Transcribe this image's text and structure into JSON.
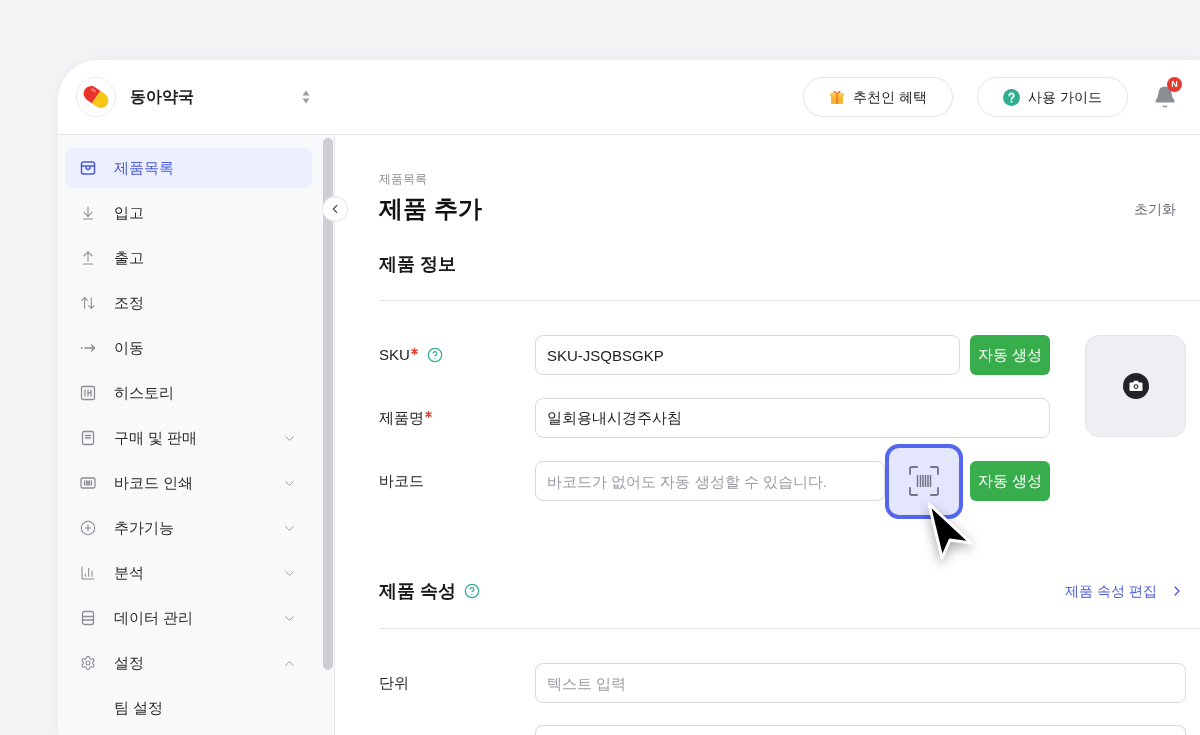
{
  "header": {
    "store_name": "동아약국",
    "buttons": [
      {
        "label": "추천인 혜택"
      },
      {
        "label": "사용 가이드"
      }
    ],
    "notification_badge": "N"
  },
  "sidebar": {
    "items": [
      {
        "label": "제품목록",
        "selected": true
      },
      {
        "label": "입고",
        "selected": false
      },
      {
        "label": "출고",
        "selected": false
      },
      {
        "label": "조정",
        "selected": false
      },
      {
        "label": "이동",
        "selected": false
      },
      {
        "label": "히스토리",
        "selected": false
      },
      {
        "label": "구매 및 판매",
        "selected": false,
        "expanded": false
      },
      {
        "label": "바코드 인쇄",
        "selected": false,
        "expanded": false
      },
      {
        "label": "추가기능",
        "selected": false,
        "expanded": false
      },
      {
        "label": "분석",
        "selected": false,
        "expanded": false
      },
      {
        "label": "데이터 관리",
        "selected": false,
        "expanded": false
      },
      {
        "label": "설정",
        "selected": false,
        "expanded": true,
        "children": [
          {
            "label": "팀 설정",
            "selected": false
          }
        ]
      }
    ]
  },
  "page": {
    "breadcrumb": "제품목록",
    "title": "제품 추가",
    "reset": "초기화"
  },
  "product_info": {
    "title": "제품 정보",
    "fields": [
      {
        "label": "SKU",
        "required": true,
        "help": true,
        "value": "SKU-JSQBSGKP",
        "button": "자동 생성"
      },
      {
        "label": "제품명",
        "required": true,
        "value": "일회용내시경주사침"
      },
      {
        "label": "바코드",
        "required": false,
        "placeholder": "바코드가 없어도 자동 생성할 수 있습니다.",
        "scan_button": {
          "highlighted": true
        },
        "button": "자동 생성"
      }
    ]
  },
  "product_attributes": {
    "title": "제품 속성",
    "help": true,
    "edit_link": "제품 속성 편집",
    "fields": [
      {
        "kind": "text_input",
        "label": "단위",
        "placeholder": "텍스트 입력"
      },
      {
        "kind": "text_input"
      }
    ]
  }
}
